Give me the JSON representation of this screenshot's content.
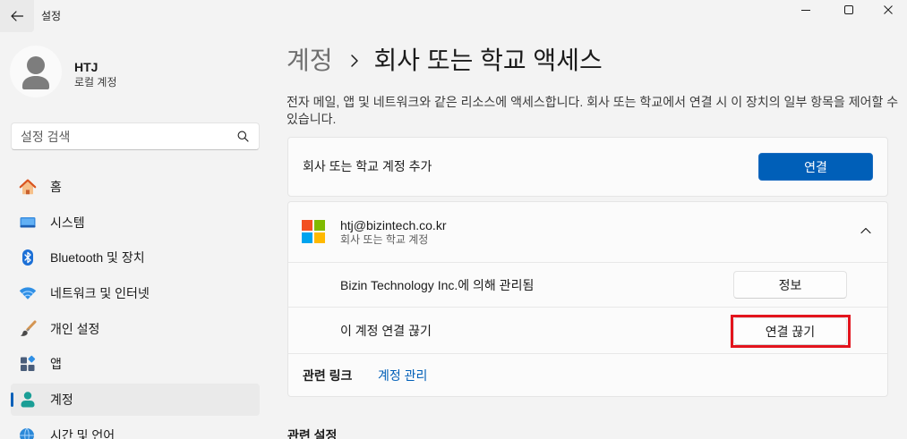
{
  "window": {
    "title": "설정",
    "back_icon": "back-arrow-icon",
    "controls": [
      {
        "icon": "minimize-icon"
      },
      {
        "icon": "maximize-icon"
      },
      {
        "icon": "close-icon"
      }
    ]
  },
  "user": {
    "name": "HTJ",
    "account_type": "로컬 계정",
    "avatar_icon": "default-avatar-icon"
  },
  "search": {
    "placeholder": "설정 검색",
    "icon": "search-icon"
  },
  "nav": {
    "items": [
      {
        "label": "홈",
        "icon": "home-icon"
      },
      {
        "label": "시스템",
        "icon": "system-icon"
      },
      {
        "label": "Bluetooth 및 장치",
        "icon": "bluetooth-icon"
      },
      {
        "label": "네트워크 및 인터넷",
        "icon": "wifi-icon"
      },
      {
        "label": "개인 설정",
        "icon": "brush-icon"
      },
      {
        "label": "앱",
        "icon": "apps-icon"
      },
      {
        "label": "계정",
        "icon": "accounts-icon",
        "selected": true
      },
      {
        "label": "시간 및 언어",
        "icon": "globe-clock-icon"
      }
    ]
  },
  "breadcrumb": {
    "parent": "계정",
    "separator_icon": "chevron-right-icon",
    "current": "회사 또는 학교 액세스"
  },
  "description": "전자 메일, 앱 및 네트워크와 같은 리소스에 액세스합니다. 회사 또는 학교에서 연결 시 이 장치의 일부 항목을 제어할 수 있습니다.",
  "add_account": {
    "label": "회사 또는 학교 계정 추가",
    "button_label": "연결"
  },
  "account": {
    "logo_icon": "microsoft-logo-icon",
    "email": "htj@bizintech.co.kr",
    "type": "회사 또는 학교 계정",
    "expanded": true,
    "expand_icon": "chevron-up-icon",
    "managed_by": "Bizin Technology Inc.에 의해 관리됨",
    "info_button_label": "정보",
    "disconnect_label": "이 계정 연결 끊기",
    "disconnect_button_label": "연결 끊기",
    "disconnect_highlighted": true
  },
  "related_links": {
    "label": "관련 링크",
    "links": [
      {
        "label": "계정 관리"
      }
    ]
  },
  "related_settings": {
    "title": "관련 설정"
  },
  "colors": {
    "accent": "#005fb8",
    "highlight": "#e3141d",
    "account-icon": "#1a9e96",
    "ms-red": "#f25022",
    "ms-green": "#7fba00",
    "ms-blue": "#00a4ef",
    "ms-yellow": "#ffb900"
  }
}
